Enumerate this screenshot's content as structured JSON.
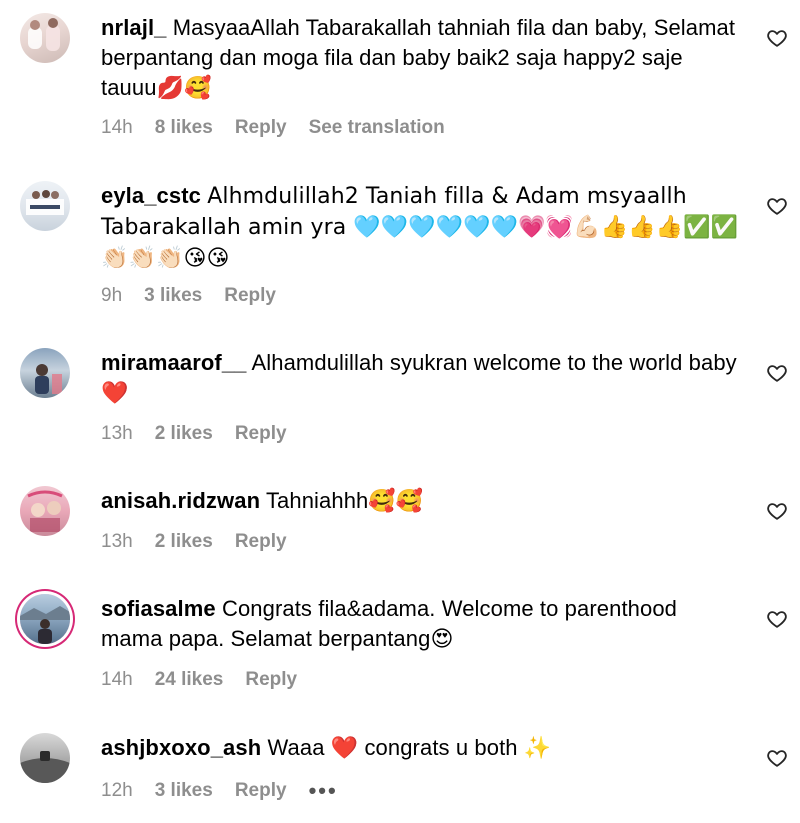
{
  "comments": [
    {
      "username": "nrlajl_",
      "text": "MasyaaAllah Tabarakallah tahniah fila dan baby, Selamat berpantang dan moga fila dan baby baik2 saja happy2 saje tauuu💋🥰",
      "time": "14h",
      "likes": "8 likes",
      "reply": "Reply",
      "extra": "See translation"
    },
    {
      "username": "eyla_cstc",
      "text": "Alhmdulillah2 Taniah filla & Adam msyaallh Tabarakallah amin yra 🩵🩵🩵🩵🩵🩵💗💓💪🏻👍👍👍✅✅👏🏻👏🏻👏🏻😘😘",
      "time": "9h",
      "likes": "3 likes",
      "reply": "Reply"
    },
    {
      "username": "miramaarof__",
      "text": "Alhamdulillah syukran welcome to the world baby ❤️",
      "time": "13h",
      "likes": "2 likes",
      "reply": "Reply"
    },
    {
      "username": "anisah.ridzwan",
      "text": "Tahniahhh🥰🥰",
      "time": "13h",
      "likes": "2 likes",
      "reply": "Reply"
    },
    {
      "username": "sofiasalme",
      "text": "Congrats fila&adama. Welcome to parenthood mama papa. Selamat berpantang😍",
      "time": "14h",
      "likes": "24 likes",
      "reply": "Reply"
    },
    {
      "username": "ashjbxoxo_ash",
      "text": "Waaa ❤️ congrats u both ✨",
      "time": "12h",
      "likes": "3 likes",
      "reply": "Reply",
      "more": "•••"
    }
  ],
  "icons": {
    "like": "heart-outline-icon",
    "more": "more-options-icon"
  },
  "colors": {
    "meta_text": "#8e8e8e",
    "story_ring": "#d62976"
  }
}
